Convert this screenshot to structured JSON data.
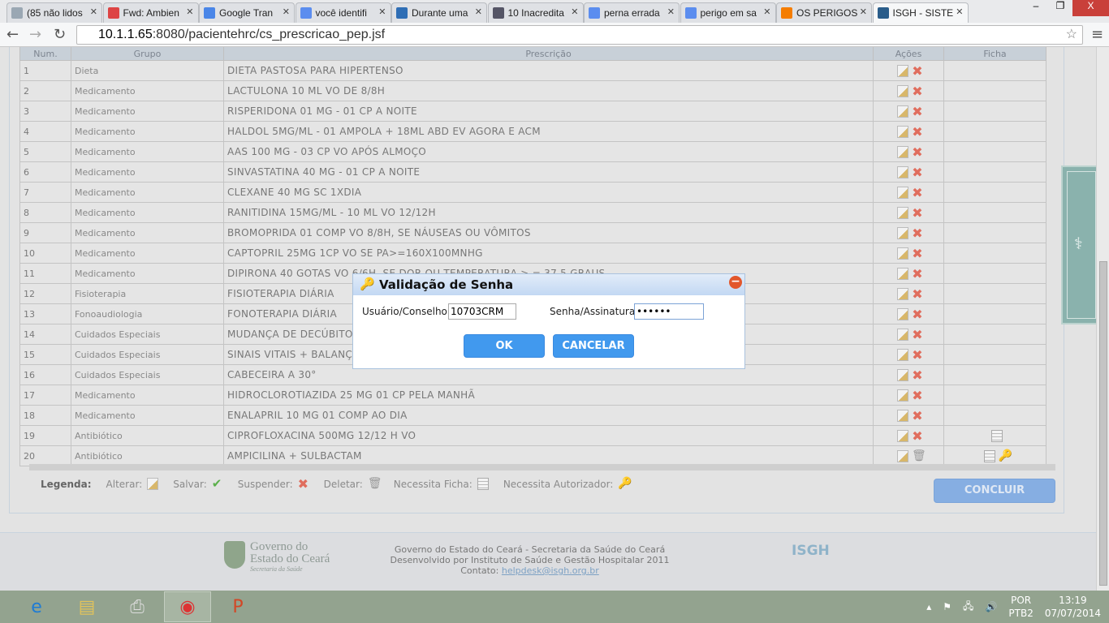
{
  "browser": {
    "tabs": [
      {
        "label": "(85 não lidos",
        "color": "#9aa7b3"
      },
      {
        "label": "Fwd: Ambien",
        "color": "#d44"
      },
      {
        "label": "Google Tran",
        "color": "#4a86e8"
      },
      {
        "label": "você identifi",
        "color": "#5b8def"
      },
      {
        "label": "Durante uma",
        "color": "#2f6eb5"
      },
      {
        "label": "10 Inacredita",
        "color": "#556"
      },
      {
        "label": "perna errada",
        "color": "#5b8def"
      },
      {
        "label": "perigo em sa",
        "color": "#5b8def"
      },
      {
        "label": "OS PERIGOS",
        "color": "#f57d00"
      },
      {
        "label": "ISGH - SISTE",
        "color": "#2a5d8a"
      }
    ],
    "url_host": "10.1.1.65",
    "url_rest": ":8080/pacientehrc/cs_prescricao_pep.jsf",
    "window_close": "X"
  },
  "table": {
    "headers": [
      "Num.",
      "Grupo",
      "Prescrição",
      "Ações",
      "Ficha"
    ],
    "rows": [
      {
        "num": "1",
        "grupo": "Dieta",
        "prescricao": "DIETA PASTOSA PARA HIPERTENSO",
        "acoes": [
          "edit",
          "suspend"
        ],
        "ficha": []
      },
      {
        "num": "2",
        "grupo": "Medicamento",
        "prescricao": "LACTULONA 10 ML VO DE 8/8H",
        "acoes": [
          "edit",
          "suspend"
        ],
        "ficha": []
      },
      {
        "num": "3",
        "grupo": "Medicamento",
        "prescricao": "RISPERIDONA 01 MG - 01 CP A NOITE",
        "acoes": [
          "edit",
          "suspend"
        ],
        "ficha": []
      },
      {
        "num": "4",
        "grupo": "Medicamento",
        "prescricao": "HALDOL 5MG/ML - 01 AMPOLA + 18ML ABD EV AGORA E ACM",
        "acoes": [
          "edit",
          "suspend"
        ],
        "ficha": []
      },
      {
        "num": "5",
        "grupo": "Medicamento",
        "prescricao": "AAS 100 MG - 03 CP VO APÓS ALMOÇO",
        "acoes": [
          "edit",
          "suspend"
        ],
        "ficha": []
      },
      {
        "num": "6",
        "grupo": "Medicamento",
        "prescricao": "SINVASTATINA 40 MG - 01 CP A NOITE",
        "acoes": [
          "edit",
          "suspend"
        ],
        "ficha": []
      },
      {
        "num": "7",
        "grupo": "Medicamento",
        "prescricao": "CLEXANE 40 MG SC 1XDIA",
        "acoes": [
          "edit",
          "suspend"
        ],
        "ficha": []
      },
      {
        "num": "8",
        "grupo": "Medicamento",
        "prescricao": "RANITIDINA 15MG/ML - 10 ML VO 12/12H",
        "acoes": [
          "edit",
          "suspend"
        ],
        "ficha": []
      },
      {
        "num": "9",
        "grupo": "Medicamento",
        "prescricao": "BROMOPRIDA 01 COMP VO 8/8H, SE NÁUSEAS OU VÔMITOS",
        "acoes": [
          "edit",
          "suspend"
        ],
        "ficha": []
      },
      {
        "num": "10",
        "grupo": "Medicamento",
        "prescricao": "CAPTOPRIL 25MG 1CP VO SE PA>=160X100MNHG",
        "acoes": [
          "edit",
          "suspend"
        ],
        "ficha": []
      },
      {
        "num": "11",
        "grupo": "Medicamento",
        "prescricao": "DIPIRONA 40 GOTAS VO 6/6H, SE DOR OU TEMPERATURA > = 37,5 GRAUS",
        "acoes": [
          "edit",
          "suspend"
        ],
        "ficha": []
      },
      {
        "num": "12",
        "grupo": "Fisioterapia",
        "prescricao": "FISIOTERAPIA DIÁRIA",
        "acoes": [
          "edit",
          "suspend"
        ],
        "ficha": []
      },
      {
        "num": "13",
        "grupo": "Fonoaudiologia",
        "prescricao": "FONOTERAPIA DIÁRIA",
        "acoes": [
          "edit",
          "suspend"
        ],
        "ficha": []
      },
      {
        "num": "14",
        "grupo": "Cuidados Especiais",
        "prescricao": "MUDANÇA DE DECÚBITO 3",
        "acoes": [
          "edit",
          "suspend"
        ],
        "ficha": []
      },
      {
        "num": "15",
        "grupo": "Cuidados Especiais",
        "prescricao": "SINAIS VITAIS + BALANÇO",
        "acoes": [
          "edit",
          "suspend"
        ],
        "ficha": []
      },
      {
        "num": "16",
        "grupo": "Cuidados Especiais",
        "prescricao": "CABECEIRA A 30°",
        "acoes": [
          "edit",
          "suspend"
        ],
        "ficha": []
      },
      {
        "num": "17",
        "grupo": "Medicamento",
        "prescricao": "HIDROCLOROTIAZIDA 25 MG 01 CP PELA MANHÃ",
        "acoes": [
          "edit",
          "suspend"
        ],
        "ficha": []
      },
      {
        "num": "18",
        "grupo": "Medicamento",
        "prescricao": "ENALAPRIL 10 MG 01 COMP AO DIA",
        "acoes": [
          "edit",
          "suspend"
        ],
        "ficha": []
      },
      {
        "num": "19",
        "grupo": "Antibiótico",
        "prescricao": "CIPROFLOXACINA 500MG 12/12 H VO",
        "acoes": [
          "edit",
          "suspend"
        ],
        "ficha": [
          "ficha"
        ]
      },
      {
        "num": "20",
        "grupo": "Antibiótico",
        "prescricao": "AMPICILINA + SULBACTAM",
        "acoes": [
          "edit",
          "delete"
        ],
        "ficha": [
          "ficha",
          "key"
        ]
      }
    ]
  },
  "legend": {
    "title": "Legenda:",
    "items": [
      {
        "label": "Alterar:",
        "icon": "edit"
      },
      {
        "label": "Salvar:",
        "icon": "save"
      },
      {
        "label": "Suspender:",
        "icon": "suspend"
      },
      {
        "label": "Deletar:",
        "icon": "delete"
      },
      {
        "label": "Necessita Ficha:",
        "icon": "ficha"
      },
      {
        "label": "Necessita Autorizador:",
        "icon": "key"
      }
    ]
  },
  "concluir_label": "CONCLUIR",
  "footer": {
    "gov_line1": "Governo do",
    "gov_line2": "Estado do Ceará",
    "gov_sub": "Secretaria da Saúde",
    "line1": "Governo do Estado do Ceará - Secretaria da Saúde do Ceará",
    "line2": "Desenvolvido por Instituto de Saúde e Gestão Hospitalar 2011",
    "contact_label": "Contato:",
    "contact_email": "helpdesk@isgh.org.br",
    "isgh_logo": "ISGH"
  },
  "dialog": {
    "title": "Validação de Senha",
    "user_label": "Usuário/Conselho:",
    "user_value": "10703CRM",
    "pass_label": "Senha/Assinatura:",
    "pass_value": "••••••",
    "ok_label": "OK",
    "cancel_label": "CANCELAR"
  },
  "taskbar": {
    "lang1": "POR",
    "lang2": "PTB2",
    "time": "13:19",
    "date": "07/07/2014"
  }
}
